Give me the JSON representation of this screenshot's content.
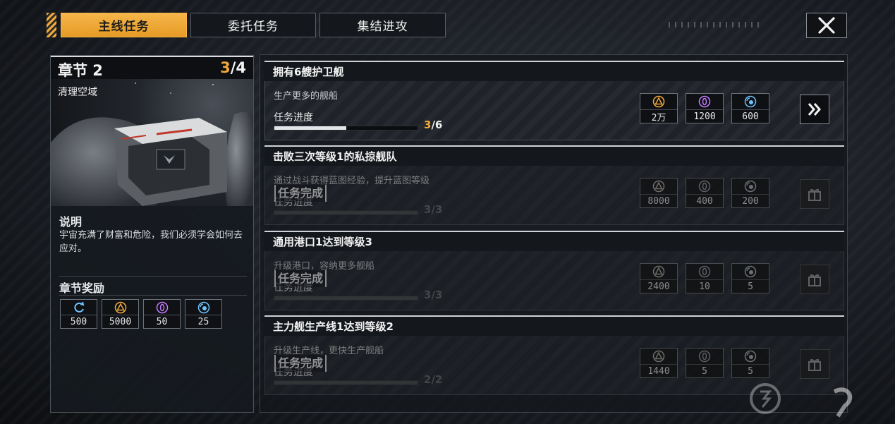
{
  "tabs": [
    {
      "label": "主线任务",
      "active": true
    },
    {
      "label": "委托任务",
      "active": false
    },
    {
      "label": "集结进攻",
      "active": false
    }
  ],
  "close_icon": "close-icon",
  "chapter": {
    "title": "章节 2",
    "progress_current": "3",
    "progress_total": "/4",
    "subtitle": "清理空域",
    "description_title": "说明",
    "description": "宇宙充满了财富和危险，我们必须学会如何去应对。",
    "reward_title": "章节奖励",
    "rewards": [
      {
        "icon": "refresh-icon",
        "value": "500"
      },
      {
        "icon": "triangle-resource-icon",
        "value": "5000"
      },
      {
        "icon": "crystal-resource-icon",
        "value": "50"
      },
      {
        "icon": "orb-resource-icon",
        "value": "25"
      }
    ]
  },
  "tasks": [
    {
      "title": "拥有6艘护卫舰",
      "description": "生产更多的舰船",
      "progress_label": "任务进度",
      "progress_current": "3",
      "progress_total": "/6",
      "progress_fraction": 0.5,
      "completed": false,
      "rewards": [
        "2万",
        "1200",
        "600"
      ],
      "action": "go-icon"
    },
    {
      "title": "击败三次等级1的私掠舰队",
      "description": "通过战斗获得蓝图经验，提升蓝图等级",
      "progress_label": "任务进度",
      "progress_current": "3",
      "progress_total": "/3",
      "progress_fraction": 1.0,
      "completed": true,
      "done_label": "任务完成",
      "rewards": [
        "8000",
        "400",
        "200"
      ],
      "action": "gift-icon"
    },
    {
      "title": "通用港口1达到等级3",
      "description": "升级港口，容纳更多舰船",
      "progress_label": "任务进度",
      "progress_current": "3",
      "progress_total": "/3",
      "progress_fraction": 1.0,
      "completed": true,
      "done_label": "任务完成",
      "rewards": [
        "2400",
        "10",
        "5"
      ],
      "action": "gift-icon"
    },
    {
      "title": "主力舰生产线1达到等级2",
      "description": "升级生产线，更快生产舰船",
      "progress_label": "任务进度",
      "progress_current": "2",
      "progress_total": "/2",
      "progress_fraction": 1.0,
      "completed": true,
      "done_label": "任务完成",
      "rewards": [
        "1440",
        "5",
        "5"
      ],
      "action": "gift-icon"
    }
  ],
  "colors": {
    "accent": "#f0a93b",
    "resource_orange": "#f0a93b",
    "resource_purple": "#c47cff",
    "resource_blue": "#6fc3ff"
  }
}
